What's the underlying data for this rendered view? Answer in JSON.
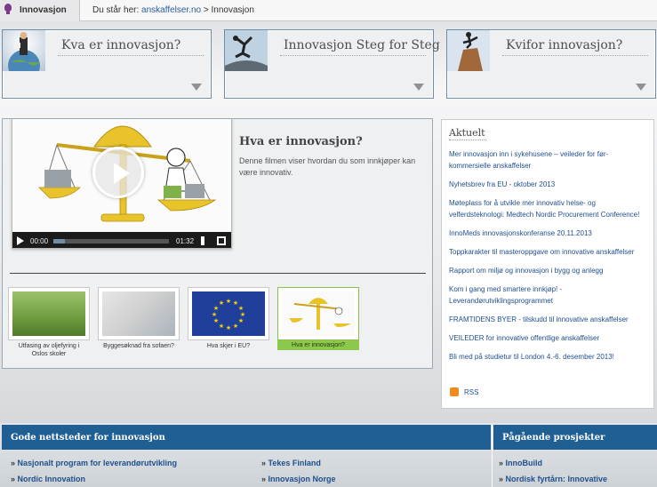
{
  "topbar": {
    "tab_label": "Innovasjon",
    "breadcrumb_prefix": "Du står her:",
    "breadcrumb_link": "anskaffelser.no",
    "breadcrumb_sep": ">",
    "breadcrumb_current": "Innovasjon"
  },
  "promos": [
    {
      "title": "Kva er innovasjon?"
    },
    {
      "title": "Innovasjon Steg for Steg"
    },
    {
      "title": "Kvifor innovasjon?"
    }
  ],
  "video": {
    "title": "Hva er innovasjon?",
    "description": "Denne filmen viser hvordan du som innkjøper kan være innovativ.",
    "current_time": "00:00",
    "duration": "01:32",
    "buffered_fraction": 0.1
  },
  "thumbnails": [
    {
      "caption": "Utfasing av oljefyring i Oslos skoler"
    },
    {
      "caption": "Byggesøknad fra sofaen?"
    },
    {
      "caption": "Hva skjer i EU?"
    },
    {
      "caption": "Hva er innovasjon?"
    }
  ],
  "news": {
    "heading": "Aktuelt",
    "items": [
      "Mer innovasjon inn i sykehusene – veileder for før-kommersielle anskaffelser",
      "Nyhetsbrev fra EU - oktober 2013",
      "Møteplass for å utvikle mer innovativ helse- og velferdsteknologi: Medtech Nordic Procurement Conference!",
      "InnoMeds innovasjonskonferanse 20.11.2013",
      "Toppkarakter til masteroppgave om innovative anskaffelser",
      "Rapport om miljø og innovasjon i bygg og anlegg",
      "Kom i gang med smartere innkjøp! - Leverandørutviklingsprogrammet",
      "FRAMTIDENS BYER - tilskudd til innovative anskaffelser",
      "VEILEDER for innovative offentlige anskaffelser",
      "Bli med på studietur til London 4.-6. desember 2013!"
    ],
    "rss_label": "RSS"
  },
  "footer": {
    "left_heading": "Gode nettsteder for innovasjon",
    "right_heading": "Pågående prosjekter",
    "col1": [
      "Nasjonalt program for leverandørutvikling",
      "Nordic Innovation"
    ],
    "col2": [
      "Tekes Finland",
      "Innovasjon Norge"
    ],
    "col3": [
      "InnoBuild",
      "Nordisk fyrtårn: Innovative"
    ]
  }
}
